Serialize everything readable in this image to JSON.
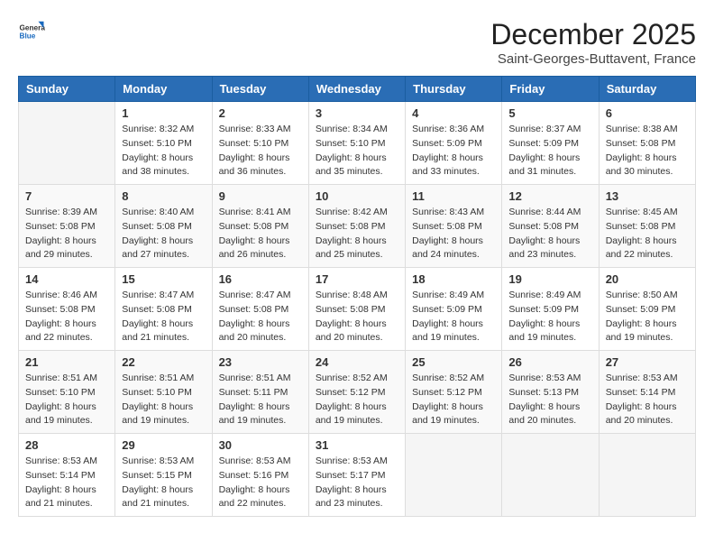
{
  "header": {
    "logo": {
      "general": "General",
      "blue": "Blue"
    },
    "title": "December 2025",
    "location": "Saint-Georges-Buttavent, France"
  },
  "weekdays": [
    "Sunday",
    "Monday",
    "Tuesday",
    "Wednesday",
    "Thursday",
    "Friday",
    "Saturday"
  ],
  "weeks": [
    [
      {
        "day": "",
        "info": ""
      },
      {
        "day": "1",
        "info": "Sunrise: 8:32 AM\nSunset: 5:10 PM\nDaylight: 8 hours\nand 38 minutes."
      },
      {
        "day": "2",
        "info": "Sunrise: 8:33 AM\nSunset: 5:10 PM\nDaylight: 8 hours\nand 36 minutes."
      },
      {
        "day": "3",
        "info": "Sunrise: 8:34 AM\nSunset: 5:10 PM\nDaylight: 8 hours\nand 35 minutes."
      },
      {
        "day": "4",
        "info": "Sunrise: 8:36 AM\nSunset: 5:09 PM\nDaylight: 8 hours\nand 33 minutes."
      },
      {
        "day": "5",
        "info": "Sunrise: 8:37 AM\nSunset: 5:09 PM\nDaylight: 8 hours\nand 31 minutes."
      },
      {
        "day": "6",
        "info": "Sunrise: 8:38 AM\nSunset: 5:08 PM\nDaylight: 8 hours\nand 30 minutes."
      }
    ],
    [
      {
        "day": "7",
        "info": "Sunrise: 8:39 AM\nSunset: 5:08 PM\nDaylight: 8 hours\nand 29 minutes."
      },
      {
        "day": "8",
        "info": "Sunrise: 8:40 AM\nSunset: 5:08 PM\nDaylight: 8 hours\nand 27 minutes."
      },
      {
        "day": "9",
        "info": "Sunrise: 8:41 AM\nSunset: 5:08 PM\nDaylight: 8 hours\nand 26 minutes."
      },
      {
        "day": "10",
        "info": "Sunrise: 8:42 AM\nSunset: 5:08 PM\nDaylight: 8 hours\nand 25 minutes."
      },
      {
        "day": "11",
        "info": "Sunrise: 8:43 AM\nSunset: 5:08 PM\nDaylight: 8 hours\nand 24 minutes."
      },
      {
        "day": "12",
        "info": "Sunrise: 8:44 AM\nSunset: 5:08 PM\nDaylight: 8 hours\nand 23 minutes."
      },
      {
        "day": "13",
        "info": "Sunrise: 8:45 AM\nSunset: 5:08 PM\nDaylight: 8 hours\nand 22 minutes."
      }
    ],
    [
      {
        "day": "14",
        "info": "Sunrise: 8:46 AM\nSunset: 5:08 PM\nDaylight: 8 hours\nand 22 minutes."
      },
      {
        "day": "15",
        "info": "Sunrise: 8:47 AM\nSunset: 5:08 PM\nDaylight: 8 hours\nand 21 minutes."
      },
      {
        "day": "16",
        "info": "Sunrise: 8:47 AM\nSunset: 5:08 PM\nDaylight: 8 hours\nand 20 minutes."
      },
      {
        "day": "17",
        "info": "Sunrise: 8:48 AM\nSunset: 5:08 PM\nDaylight: 8 hours\nand 20 minutes."
      },
      {
        "day": "18",
        "info": "Sunrise: 8:49 AM\nSunset: 5:09 PM\nDaylight: 8 hours\nand 19 minutes."
      },
      {
        "day": "19",
        "info": "Sunrise: 8:49 AM\nSunset: 5:09 PM\nDaylight: 8 hours\nand 19 minutes."
      },
      {
        "day": "20",
        "info": "Sunrise: 8:50 AM\nSunset: 5:09 PM\nDaylight: 8 hours\nand 19 minutes."
      }
    ],
    [
      {
        "day": "21",
        "info": "Sunrise: 8:51 AM\nSunset: 5:10 PM\nDaylight: 8 hours\nand 19 minutes."
      },
      {
        "day": "22",
        "info": "Sunrise: 8:51 AM\nSunset: 5:10 PM\nDaylight: 8 hours\nand 19 minutes."
      },
      {
        "day": "23",
        "info": "Sunrise: 8:51 AM\nSunset: 5:11 PM\nDaylight: 8 hours\nand 19 minutes."
      },
      {
        "day": "24",
        "info": "Sunrise: 8:52 AM\nSunset: 5:12 PM\nDaylight: 8 hours\nand 19 minutes."
      },
      {
        "day": "25",
        "info": "Sunrise: 8:52 AM\nSunset: 5:12 PM\nDaylight: 8 hours\nand 19 minutes."
      },
      {
        "day": "26",
        "info": "Sunrise: 8:53 AM\nSunset: 5:13 PM\nDaylight: 8 hours\nand 20 minutes."
      },
      {
        "day": "27",
        "info": "Sunrise: 8:53 AM\nSunset: 5:14 PM\nDaylight: 8 hours\nand 20 minutes."
      }
    ],
    [
      {
        "day": "28",
        "info": "Sunrise: 8:53 AM\nSunset: 5:14 PM\nDaylight: 8 hours\nand 21 minutes."
      },
      {
        "day": "29",
        "info": "Sunrise: 8:53 AM\nSunset: 5:15 PM\nDaylight: 8 hours\nand 21 minutes."
      },
      {
        "day": "30",
        "info": "Sunrise: 8:53 AM\nSunset: 5:16 PM\nDaylight: 8 hours\nand 22 minutes."
      },
      {
        "day": "31",
        "info": "Sunrise: 8:53 AM\nSunset: 5:17 PM\nDaylight: 8 hours\nand 23 minutes."
      },
      {
        "day": "",
        "info": ""
      },
      {
        "day": "",
        "info": ""
      },
      {
        "day": "",
        "info": ""
      }
    ]
  ]
}
